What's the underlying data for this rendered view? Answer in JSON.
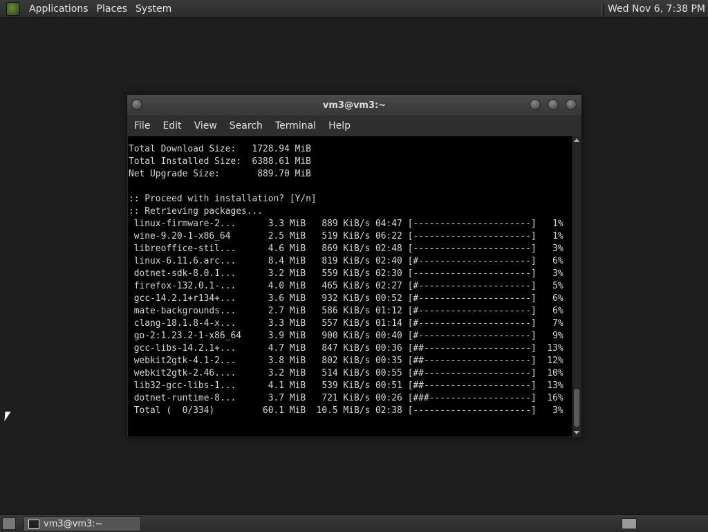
{
  "top_panel": {
    "menus": [
      "Applications",
      "Places",
      "System"
    ],
    "clock": "Wed Nov  6,  7:38 PM"
  },
  "window": {
    "title": "vm3@vm3:~",
    "menu": [
      "File",
      "Edit",
      "View",
      "Search",
      "Terminal",
      "Help"
    ]
  },
  "terminal": {
    "lines": [
      "Total Download Size:   1728.94 MiB",
      "Total Installed Size:  6388.61 MiB",
      "Net Upgrade Size:       889.70 MiB",
      "",
      ":: Proceed with installation? [Y/n]",
      ":: Retrieving packages...",
      " linux-firmware-2...      3.3 MiB   889 KiB/s 04:47 [----------------------]   1%",
      " wine-9.20-1-x86_64       2.5 MiB   519 KiB/s 06:22 [----------------------]   1%",
      " libreoffice-stil...      4.6 MiB   869 KiB/s 02:48 [----------------------]   3%",
      " linux-6.11.6.arc...      8.4 MiB   819 KiB/s 02:40 [#---------------------]   6%",
      " dotnet-sdk-8.0.1...      3.2 MiB   559 KiB/s 02:30 [----------------------]   3%",
      " firefox-132.0.1-...      4.0 MiB   465 KiB/s 02:27 [#---------------------]   5%",
      " gcc-14.2.1+r134+...      3.6 MiB   932 KiB/s 00:52 [#---------------------]   6%",
      " mate-backgrounds...      2.7 MiB   586 KiB/s 01:12 [#---------------------]   6%",
      " clang-18.1.8-4-x...      3.3 MiB   557 KiB/s 01:14 [#---------------------]   7%",
      " go-2:1.23.2-1-x86_64     3.9 MiB   900 KiB/s 00:40 [#---------------------]   9%",
      " gcc-libs-14.2.1+...      4.7 MiB   847 KiB/s 00:36 [##--------------------]  13%",
      " webkit2gtk-4.1-2...      3.8 MiB   802 KiB/s 00:35 [##--------------------]  12%",
      " webkit2gtk-2.46....      3.2 MiB   514 KiB/s 00:55 [##--------------------]  10%",
      " lib32-gcc-libs-1...      4.1 MiB   539 KiB/s 00:51 [##--------------------]  13%",
      " dotnet-runtime-8...      3.7 MiB   721 KiB/s 00:26 [###-------------------]  16%",
      " Total (  0/334)         60.1 MiB  10.5 MiB/s 02:38 [----------------------]   3%"
    ]
  },
  "taskbar": {
    "task_label": "vm3@vm3:~"
  }
}
